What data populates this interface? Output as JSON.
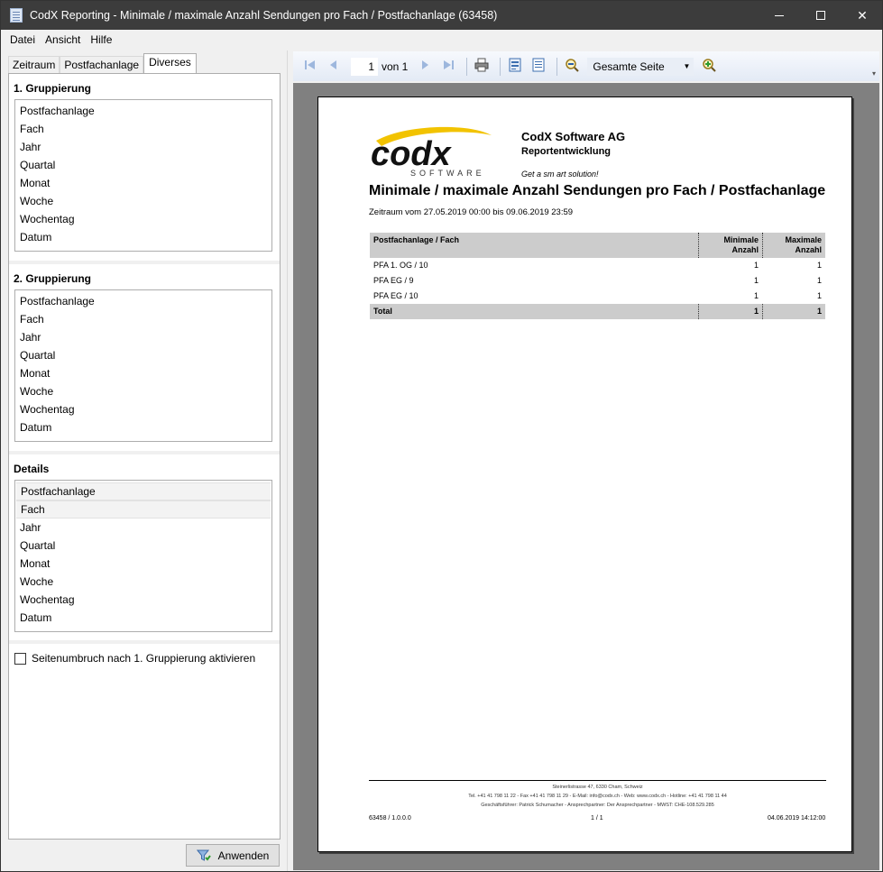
{
  "window": {
    "title": "CodX Reporting - Minimale / maximale Anzahl Sendungen pro Fach / Postfachanlage (63458)"
  },
  "menu": [
    "Datei",
    "Ansicht",
    "Hilfe"
  ],
  "tabs": [
    "Zeitraum",
    "Postfachanlage",
    "Diverses"
  ],
  "active_tab": "Diverses",
  "groups": [
    {
      "title": "1. Gruppierung",
      "items": [
        "Postfachanlage",
        "Fach",
        "Jahr",
        "Quartal",
        "Monat",
        "Woche",
        "Wochentag",
        "Datum"
      ]
    },
    {
      "title": "2. Gruppierung",
      "items": [
        "Postfachanlage",
        "Fach",
        "Jahr",
        "Quartal",
        "Monat",
        "Woche",
        "Wochentag",
        "Datum"
      ]
    },
    {
      "title": "Details",
      "items": [
        "Postfachanlage",
        "Fach",
        "Jahr",
        "Quartal",
        "Monat",
        "Woche",
        "Wochentag",
        "Datum"
      ],
      "selected": [
        "Postfachanlage",
        "Fach"
      ]
    }
  ],
  "page_break_checkbox": {
    "label": "Seitenumbruch nach 1. Gruppierung aktivieren",
    "checked": false
  },
  "apply_button": "Anwenden",
  "toolbar": {
    "current_page": "1",
    "of_label": "von 1",
    "zoom": "Gesamte Seite"
  },
  "report": {
    "company": "CodX Software AG",
    "department": "Reportentwicklung",
    "slogan": "Get a sm art solution!",
    "logo_text": "codx",
    "logo_sub": "SOFTWARE",
    "title": "Minimale / maximale Anzahl Sendungen pro Fach / Postfachanlage",
    "period": "Zeitraum vom 27.05.2019 00:00 bis 09.06.2019 23:59",
    "table": {
      "headers": [
        "Postfachanlage / Fach",
        "Minimale\nAnzahl",
        "Maximale\nAnzahl"
      ],
      "rows": [
        [
          "PFA 1. OG / 10",
          "1",
          "1"
        ],
        [
          "PFA EG / 9",
          "1",
          "1"
        ],
        [
          "PFA EG / 10",
          "1",
          "1"
        ]
      ],
      "total": [
        "Total",
        "1",
        "1"
      ]
    },
    "footer": {
      "line1": "Steinerlistrasse 47, 6330 Cham, Schweiz",
      "line2": "Tel. +41 41 798 11 22 - Fax +41 41 798 11 29 - E-Mail: info@codx.ch - Web: www.codx.ch - Hotline: +41 41 798 11 44",
      "line3": "Geschäftsführer: Patrick Schumacher - Ansprechpartner: Der Ansprechpartner - MWST: CHE-108.529.285",
      "version": "63458 / 1.0.0.0",
      "page": "1 / 1",
      "timestamp": "04.06.2019 14:12:00"
    }
  },
  "colors": {
    "titlebar": "#3c3c3c",
    "toolbar_icons": "#5a86c8",
    "logo_swoosh": "#f2c300",
    "table_header": "#cccccc",
    "canvas": "#808080"
  }
}
